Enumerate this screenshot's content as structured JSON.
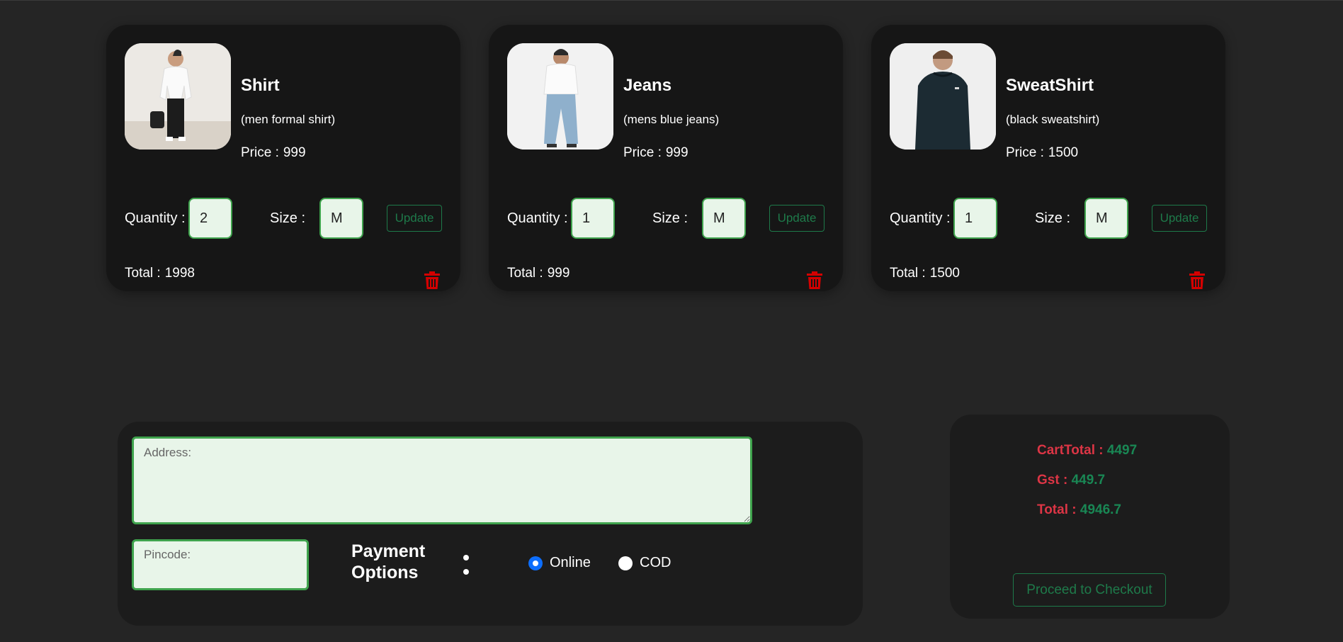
{
  "cart": {
    "items": [
      {
        "name": "Shirt",
        "description": "(men formal shirt)",
        "price_label": "Price :",
        "price": "999",
        "quantity_label": "Quantity :",
        "quantity": "2",
        "size_label": "Size :",
        "size": "M",
        "update_label": "Update",
        "total_label": "Total :",
        "total": "1998",
        "image": "man-in-white-formal-shirt-photo"
      },
      {
        "name": "Jeans",
        "description": "(mens blue jeans)",
        "price_label": "Price :",
        "price": "999",
        "quantity_label": "Quantity :",
        "quantity": "1",
        "size_label": "Size :",
        "size": "M",
        "update_label": "Update",
        "total_label": "Total :",
        "total": "999",
        "image": "man-in-blue-jeans-photo"
      },
      {
        "name": "SweatShirt",
        "description": "(black sweatshirt)",
        "price_label": "Price :",
        "price": "1500",
        "quantity_label": "Quantity :",
        "quantity": "1",
        "size_label": "Size :",
        "size": "M",
        "update_label": "Update",
        "total_label": "Total :",
        "total": "1500",
        "image": "man-in-black-sweatshirt-photo"
      }
    ],
    "delete_icon": "trash-icon"
  },
  "address_form": {
    "address_placeholder": "Address:",
    "address_value": "",
    "pincode_placeholder": "Pincode:",
    "pincode_value": "",
    "payment_label": "Payment Options",
    "payment_options": [
      {
        "label": "Online",
        "selected": true
      },
      {
        "label": "COD",
        "selected": false
      }
    ]
  },
  "summary": {
    "cart_total_label": "CartTotal :",
    "cart_total": "4497",
    "gst_label": "Gst :",
    "gst": "449.7",
    "total_label": "Total :",
    "total": "4946.7",
    "checkout_label": "Proceed to Checkout"
  },
  "colors": {
    "background": "#252525",
    "card": "#161616",
    "panel": "#1c1c1c",
    "accent_green": "#3fa34d",
    "button_green": "#1e7a4a",
    "summary_label": "#dc3545",
    "summary_value": "#198754",
    "danger": "#d40000",
    "radio_selected": "#0d6efd"
  }
}
